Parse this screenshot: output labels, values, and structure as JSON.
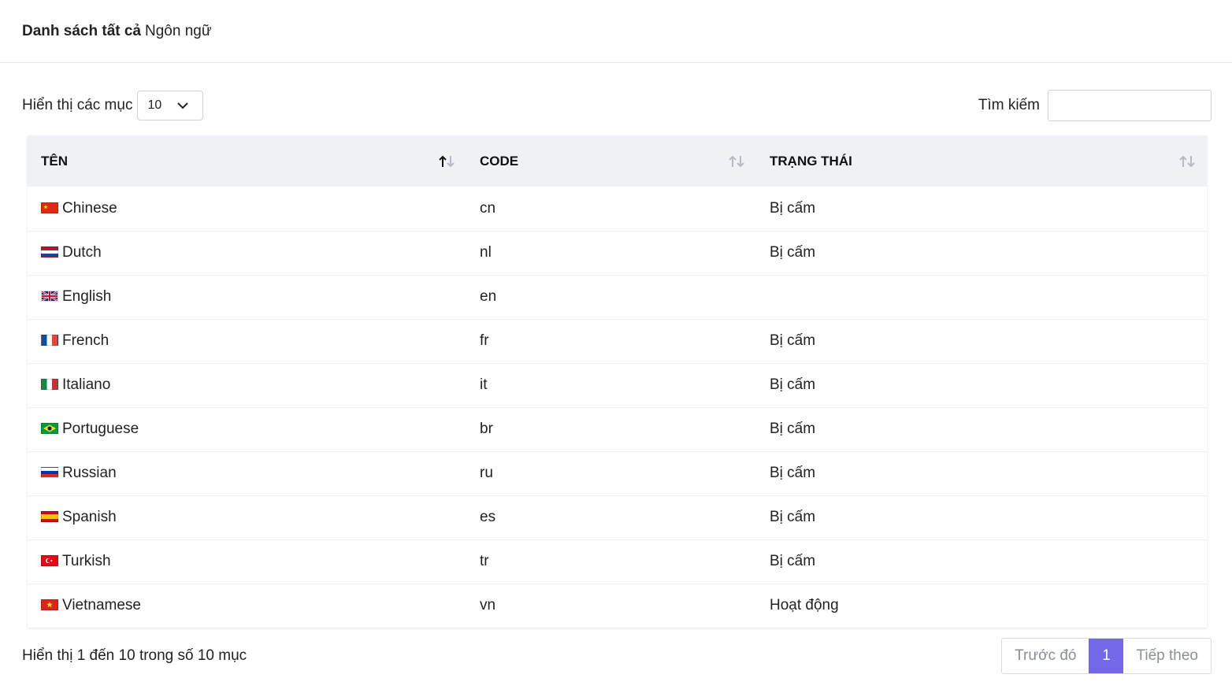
{
  "header": {
    "title_bold": "Danh sách tất cả",
    "title_rest": "Ngôn ngữ"
  },
  "controls": {
    "length_label": "Hiển thị các mục",
    "length_value": "10",
    "search_label": "Tìm kiếm",
    "search_value": ""
  },
  "table": {
    "columns": [
      "TÊN",
      "CODE",
      "TRẠNG THÁI"
    ],
    "rows": [
      {
        "name": "Chinese",
        "code": "cn",
        "status": "Bị cấm",
        "flag": "cn"
      },
      {
        "name": "Dutch",
        "code": "nl",
        "status": "Bị cấm",
        "flag": "nl"
      },
      {
        "name": "English",
        "code": "en",
        "status": "",
        "flag": "gb"
      },
      {
        "name": "French",
        "code": "fr",
        "status": "Bị cấm",
        "flag": "fr"
      },
      {
        "name": "Italiano",
        "code": "it",
        "status": "Bị cấm",
        "flag": "it"
      },
      {
        "name": "Portuguese",
        "code": "br",
        "status": "Bị cấm",
        "flag": "br"
      },
      {
        "name": "Russian",
        "code": "ru",
        "status": "Bị cấm",
        "flag": "ru"
      },
      {
        "name": "Spanish",
        "code": "es",
        "status": "Bị cấm",
        "flag": "es"
      },
      {
        "name": "Turkish",
        "code": "tr",
        "status": "Bị cấm",
        "flag": "tr"
      },
      {
        "name": "Vietnamese",
        "code": "vn",
        "status": "Hoạt động",
        "flag": "vn"
      }
    ]
  },
  "footer": {
    "info": "Hiển thị 1 đến 10 trong số 10 mục",
    "prev": "Trước đó",
    "page": "1",
    "next": "Tiếp theo"
  },
  "colors": {
    "accent": "#7468e8",
    "header_bg": "#eff1f5"
  }
}
